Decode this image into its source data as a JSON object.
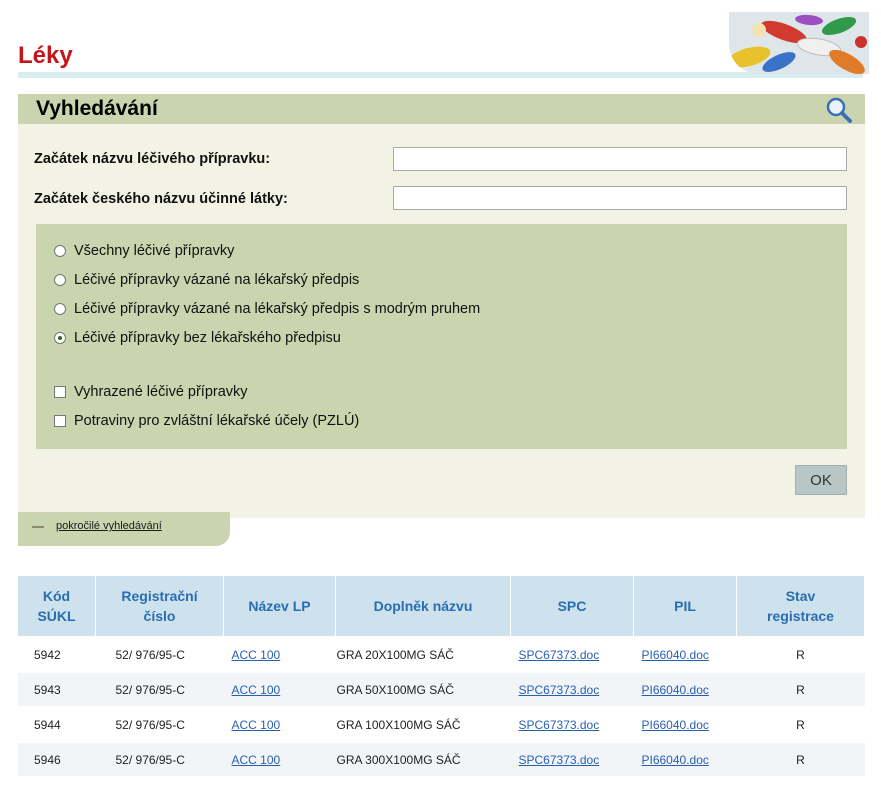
{
  "page": {
    "title": "Léky"
  },
  "search": {
    "title": "Vyhledávání",
    "fields": [
      {
        "label": "Začátek názvu léčivého přípravku:",
        "value": ""
      },
      {
        "label": "Začátek českého názvu účinné látky:",
        "value": ""
      }
    ],
    "radios": [
      {
        "label": "Všechny léčivé přípravky",
        "checked": false
      },
      {
        "label": "Léčivé přípravky vázané na lékařský předpis",
        "checked": false
      },
      {
        "label": "Léčivé přípravky vázané na lékařský předpis s modrým pruhem",
        "checked": false
      },
      {
        "label": "Léčivé přípravky bez lékařského předpisu",
        "checked": true
      }
    ],
    "checkboxes": [
      {
        "label": "Vyhrazené léčivé přípravky",
        "checked": false
      },
      {
        "label": "Potraviny pro zvláštní lékařské účely (PZLÚ)",
        "checked": false
      }
    ],
    "ok_label": "OK",
    "advanced_label": "pokročilé vyhledávání"
  },
  "results": {
    "headers": {
      "kod_1": "Kód",
      "kod_2": "SÚKL",
      "reg_1": "Registrační",
      "reg_2": "číslo",
      "nazev": "Název LP",
      "doplnek": "Doplněk názvu",
      "spc": "SPC",
      "pil": "PIL",
      "stav_1": "Stav",
      "stav_2": "registrace"
    },
    "rows": [
      {
        "kod": "5942",
        "reg": "52/ 976/95-C",
        "nazev": "ACC 100",
        "doplnek": "GRA 20X100MG SÁČ",
        "spc": "SPC67373.doc",
        "pil": "PI66040.doc",
        "stav": "R"
      },
      {
        "kod": "5943",
        "reg": "52/ 976/95-C",
        "nazev": "ACC 100",
        "doplnek": "GRA 50X100MG SÁČ",
        "spc": "SPC67373.doc",
        "pil": "PI66040.doc",
        "stav": "R"
      },
      {
        "kod": "5944",
        "reg": "52/ 976/95-C",
        "nazev": "ACC 100",
        "doplnek": "GRA 100X100MG SÁČ",
        "spc": "SPC67373.doc",
        "pil": "PI66040.doc",
        "stav": "R"
      },
      {
        "kod": "5946",
        "reg": "52/ 976/95-C",
        "nazev": "ACC 100",
        "doplnek": "GRA 300X100MG SÁČ",
        "spc": "SPC67373.doc",
        "pil": "PI66040.doc",
        "stav": "R"
      }
    ]
  },
  "icons": {
    "search": "magnifier-icon",
    "header_image": "pills-image"
  },
  "colors": {
    "title": "#c5141a",
    "panel": "#cad4ae",
    "panel_bg": "#f2f2e5",
    "table_header": "#cde2ec",
    "header_text": "#2a6db0",
    "link": "#2a5fb0"
  }
}
